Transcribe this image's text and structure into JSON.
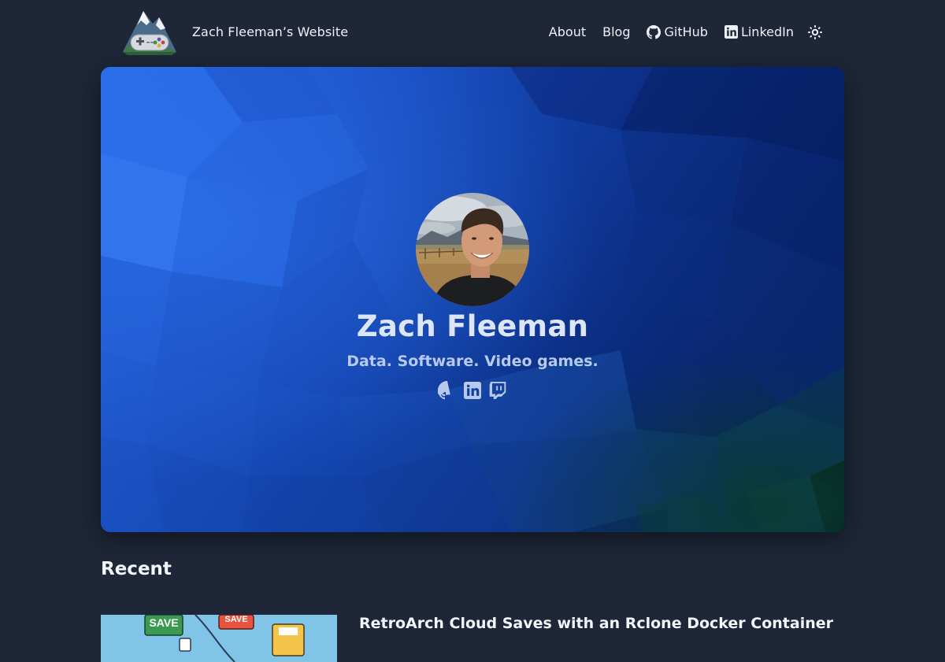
{
  "site": {
    "title": "Zach Fleeman’s Website"
  },
  "nav": {
    "items": [
      {
        "label": "About"
      },
      {
        "label": "Blog"
      },
      {
        "label": "GitHub",
        "icon": "github-icon"
      },
      {
        "label": "LinkedIn",
        "icon": "linkedin-icon"
      }
    ],
    "theme_toggle_icon": "sun-icon"
  },
  "hero": {
    "name": "Zach Fleeman",
    "tagline": "Data. Software. Video games.",
    "social_icons": [
      "github-icon",
      "linkedin-icon",
      "twitch-icon"
    ]
  },
  "recent": {
    "heading": "Recent",
    "posts": [
      {
        "title": "RetroArch Cloud Saves with an Rclone Docker Container",
        "thumb_text": [
          "SAVE",
          "SAVE"
        ]
      }
    ]
  },
  "colors": {
    "background": "#1e2637",
    "hero_blue": "#1a4fc2",
    "text": "#eef1f7"
  }
}
